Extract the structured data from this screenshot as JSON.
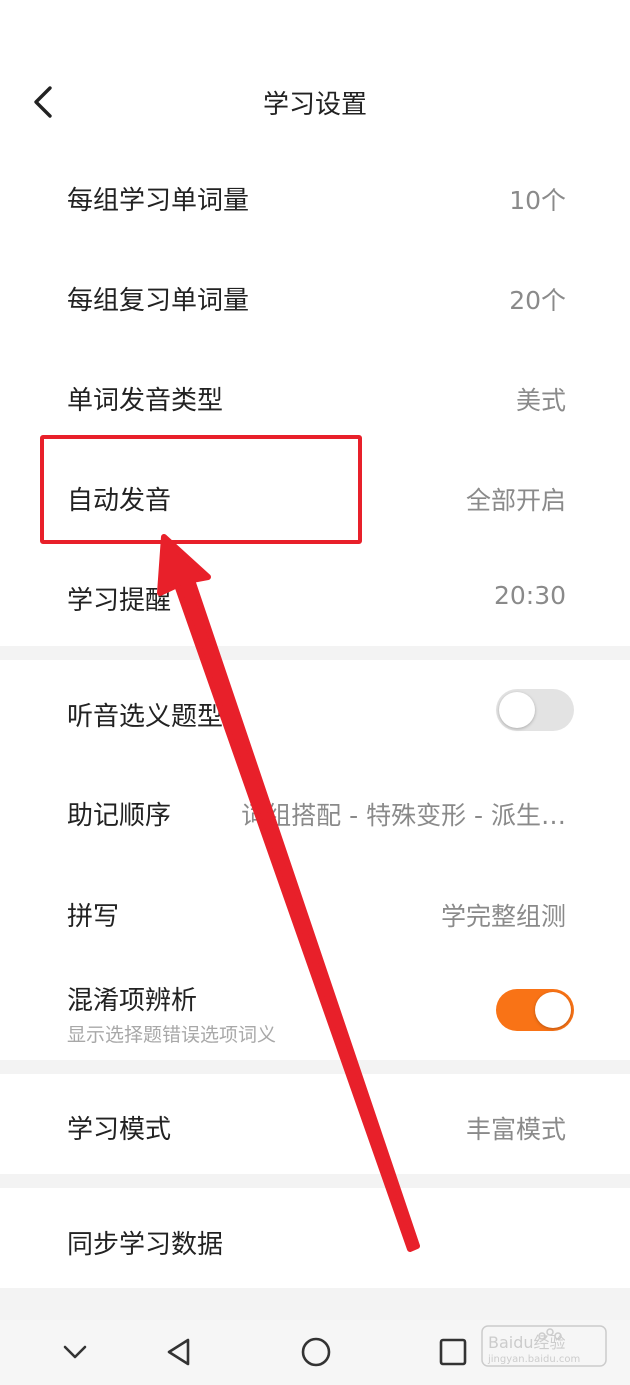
{
  "header": {
    "title": "学习设置",
    "back_icon": "chevron-left-icon"
  },
  "settings_group_1": [
    {
      "label": "每组学习单词量",
      "value": "10个"
    },
    {
      "label": "每组复习单词量",
      "value": "20个"
    },
    {
      "label": "单词发音类型",
      "value": "美式"
    },
    {
      "label": "自动发音",
      "value": "全部开启"
    },
    {
      "label": "学习提醒",
      "value": "20:30"
    }
  ],
  "settings_group_2": {
    "listening_quiz": {
      "label": "听音选义题型",
      "toggle_on": false
    },
    "mnemonic_order": {
      "label": "助记顺序",
      "value": "词组搭配 - 特殊变形 - 派生…"
    },
    "spelling": {
      "label": "拼写",
      "value": "学完整组测"
    },
    "confusion_analysis": {
      "label": "混淆项辨析",
      "subtitle": "显示选择题错误选项词义",
      "toggle_on": true
    }
  },
  "settings_group_3": {
    "study_mode": {
      "label": "学习模式",
      "value": "丰富模式"
    }
  },
  "settings_group_4": {
    "sync": {
      "label": "同步学习数据"
    }
  },
  "nav_bar": {
    "icons": [
      "chevron-down-icon",
      "back-triangle-icon",
      "home-circle-icon",
      "recents-square-icon"
    ]
  },
  "colors": {
    "accent": "#f97316",
    "annotation_red": "#e8202a"
  },
  "watermark": {
    "brand": "Baidu经验",
    "url": "jingyan.baidu.com"
  }
}
